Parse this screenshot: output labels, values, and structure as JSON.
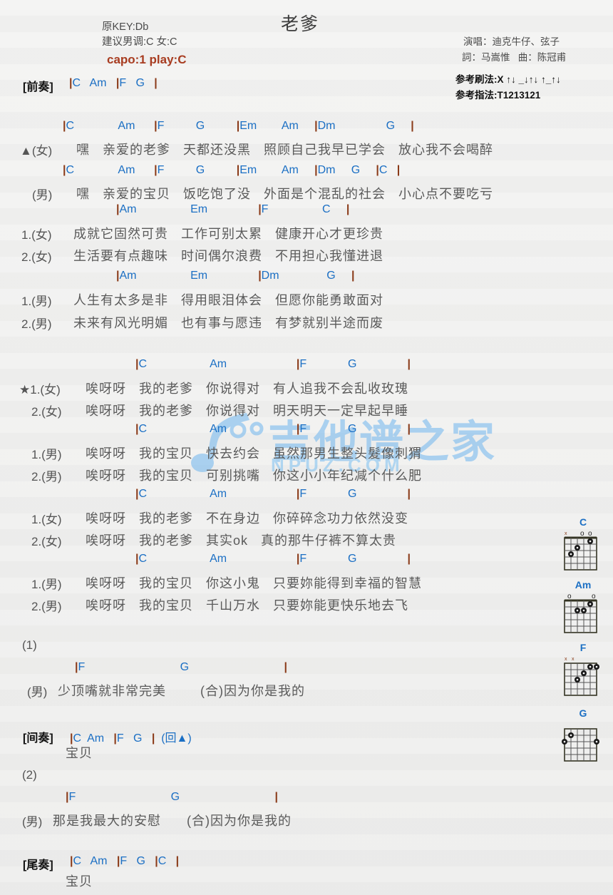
{
  "title": "老爹",
  "header": {
    "orig_key": "原KEY:Db",
    "suggest_key": "建议男调:C 女:C",
    "capo": "capo:1 play:C"
  },
  "credits": {
    "singer": "演唱：迪克牛仔、弦子",
    "writer": "詞：马嵩惟   曲：陈冠甫",
    "strum": "参考刷法:X ↑↓ _↓↑↓ ↑_↑↓",
    "fingering": "参考指法:T1213121"
  },
  "watermark": {
    "text": "吉他谱之家",
    "sub": "NPUZ.COM"
  },
  "sections": {
    "intro_label": "[前奏]",
    "intro_chords": "|C   Am   |F   G   |",
    "interlude_label": "[间奏]",
    "interlude_chords": "|C  Am   |F   G   |  (回▲)",
    "interlude_lyric": "宝贝",
    "outro_label": "[尾奏]",
    "outro_chords": "|C   Am   |F   G   |C   |",
    "outro_lyric": "宝贝",
    "ending1_label": "(1)",
    "ending2_label": "(2)"
  },
  "verse_a": {
    "row1_chords": "|C              Am      |F          G          |Em        Am     |Dm                G     |",
    "row1_marker": "▲(女)",
    "row1_lyric": "嘿   亲爱的老爹   天都还没黑   照顾自己我早已学会   放心我不会喝醉",
    "row2_chords": "|C              Am      |F          G          |Em        Am     |Dm     G     |C   |",
    "row2_marker": "(男)",
    "row2_lyric": "嘿   亲爱的宝贝   饭吃饱了没   外面是个混乱的社会   小心点不要吃亏"
  },
  "verse_b": {
    "block1_chords": "|Am                 Em                |F                 C     |",
    "block1_line1_marker": "1.(女)",
    "block1_line1_lyric": "成就它固然可贵   工作可别太累   健康开心才更珍贵",
    "block1_line2_marker": "2.(女)",
    "block1_line2_lyric": "生活要有点趣味   时间偶尔浪费   不用担心我懂进退",
    "block2_chords": "|Am                 Em                |Dm               G     |",
    "block2_line1_marker": "1.(男)",
    "block2_line1_lyric": "人生有太多是非   得用眼泪体会   但愿你能勇敢面对",
    "block2_line2_marker": "2.(男)",
    "block2_line2_lyric": "未来有风光明媚   也有事与愿违   有梦就别半途而废"
  },
  "chorus": [
    {
      "chords": "|C                    Am                      |F             G                |",
      "line1_marker": "★1.(女)",
      "line1_lyric": "唉呀呀   我的老爹   你说得对   有人追我不会乱收玫瑰",
      "line2_marker": "2.(女)",
      "line2_lyric": "唉呀呀   我的老爹   你说得对   明天明天一定早起早睡"
    },
    {
      "chords": "|C                    Am                      |F             G                |",
      "line1_marker": "1.(男)",
      "line1_lyric": "唉呀呀   我的宝贝   快去约会   虽然那男生整头髮像刺猬",
      "line2_marker": "2.(男)",
      "line2_lyric": "唉呀呀   我的宝贝   可别挑嘴   你这小小年纪减个什么肥"
    },
    {
      "chords": "|C                    Am                      |F             G                |",
      "line1_marker": "1.(女)",
      "line1_lyric": "唉呀呀   我的老爹   不在身边   你碎碎念功力依然没变",
      "line2_marker": "2.(女)",
      "line2_lyric": "唉呀呀   我的老爹   其实ok   真的那牛仔裤不算太贵"
    },
    {
      "chords": "|C                    Am                      |F             G                |",
      "line1_marker": "1.(男)",
      "line1_lyric": "唉呀呀   我的宝贝   你这小鬼   只要妳能得到幸福的智慧",
      "line2_marker": "2.(男)",
      "line2_lyric": "唉呀呀   我的宝贝   千山万水   只要妳能更快乐地去飞"
    }
  ],
  "ending1": {
    "chords": "|F                              G                              |",
    "marker": "(男)",
    "lyric": "少顶嘴就非常完美        (合)因为你是我的"
  },
  "ending2": {
    "chords": "|F                              G                              |",
    "marker": "(男)",
    "lyric": "那是我最大的安慰      (合)因为你是我的"
  },
  "chord_diagrams": [
    {
      "name": "C",
      "top_marks": [
        "x",
        "",
        "",
        "o",
        "o"
      ],
      "dots": [
        [
          2,
          3
        ],
        [
          4,
          2
        ],
        [
          5,
          1
        ]
      ]
    },
    {
      "name": "Am",
      "top_marks": [
        "",
        "o",
        "",
        "",
        "o"
      ],
      "dots": [
        [
          2,
          2
        ],
        [
          3,
          2
        ],
        [
          4,
          1
        ]
      ]
    },
    {
      "name": "F",
      "top_marks": [
        "x",
        "x",
        "",
        "",
        ""
      ],
      "dots": [
        [
          3,
          3
        ],
        [
          4,
          2
        ],
        [
          5,
          1
        ],
        [
          6,
          1
        ]
      ]
    },
    {
      "name": "G",
      "top_marks": [
        "",
        "",
        "",
        "",
        ""
      ],
      "dots": [
        [
          1,
          3
        ],
        [
          2,
          2
        ],
        [
          6,
          3
        ]
      ]
    }
  ],
  "colors": {
    "chord": "#1b6fc4",
    "bar": "#8a3a18",
    "capo": "#a83c20",
    "lyric": "#5a5a5a",
    "watermark": "#6fb6ef"
  }
}
